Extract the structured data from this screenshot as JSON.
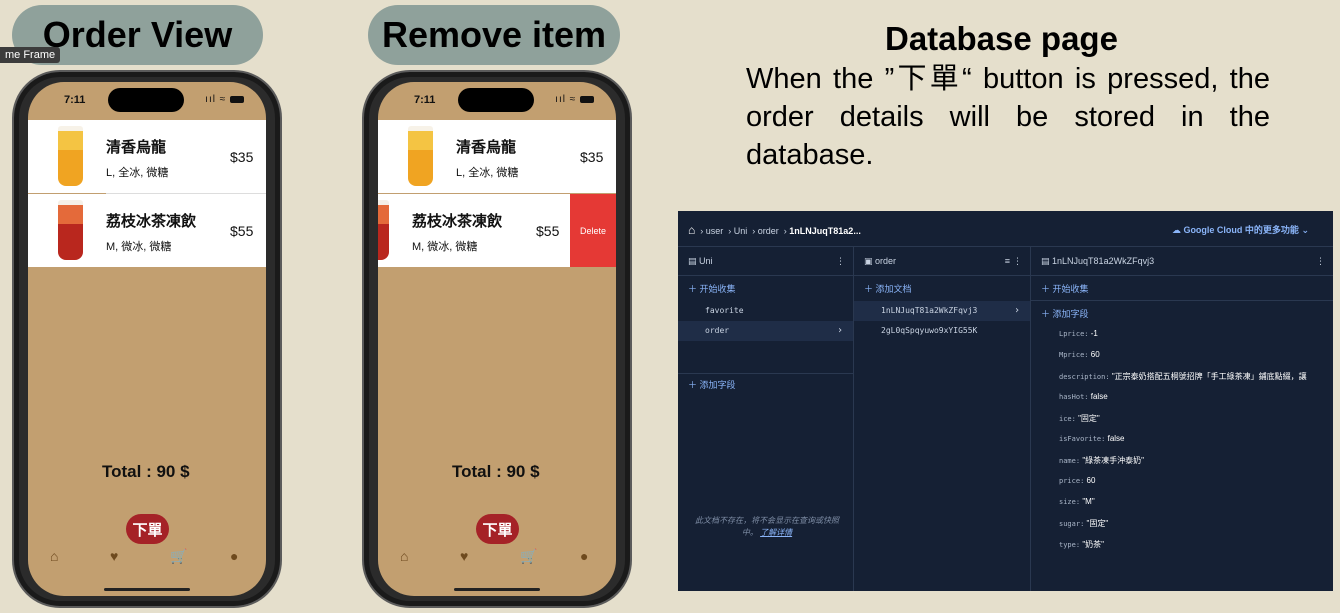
{
  "frame_tag": "me Frame",
  "panels": {
    "order_view": "Order View",
    "remove_item": "Remove item",
    "database_page": "Database page"
  },
  "description": "When the ”下單“ button is pressed, the order details will be stored in the database.",
  "phone": {
    "time": "7:11",
    "items": [
      {
        "name": "清香烏龍",
        "options": "L, 全冰, 微糖",
        "price": "$35"
      },
      {
        "name": "荔枝冰茶凍飲",
        "options": "M, 微冰, 微糖",
        "price": "$55"
      }
    ],
    "delete_label": "Delete",
    "total": "Total : 90 $",
    "order_button": "下單",
    "nav_icons": [
      "home-icon",
      "heart-icon",
      "cart-icon",
      "person-icon"
    ],
    "accent_color": "#1e88e5"
  },
  "console": {
    "breadcrumb": [
      "user",
      "Uni",
      "order",
      "1nLNJuqT81a2..."
    ],
    "google_cloud": "Google Cloud 中的更多功能",
    "col1": {
      "title": "Uni",
      "add_collection": "开始收集",
      "items": [
        "favorite",
        "order"
      ],
      "add_field": "添加字段",
      "note": "此文档不存在，将不会显示在查询或快照中。",
      "note_link": "了解详情"
    },
    "col2": {
      "title": "order",
      "add_doc": "添加文档",
      "items": [
        "1nLNJuqT81a2WkZFqvj3",
        "2gL0qSpqyuwo9xYIG55K"
      ]
    },
    "col3": {
      "title": "1nLNJuqT81a2WkZFqvj3",
      "add_collection": "开始收集",
      "add_field": "添加字段",
      "fields": [
        {
          "key": "Lprice:",
          "value": "-1"
        },
        {
          "key": "Mprice:",
          "value": "60"
        },
        {
          "key": "description:",
          "value": "\"正宗泰奶搭配五桐號招牌「手工綠茶凍」鋪底點綴，讓"
        },
        {
          "key": "hasHot:",
          "value": "false"
        },
        {
          "key": "ice:",
          "value": "\"固定\""
        },
        {
          "key": "isFavorite:",
          "value": "false"
        },
        {
          "key": "name:",
          "value": "\"綠茶凍手沖泰奶\""
        },
        {
          "key": "price:",
          "value": "60"
        },
        {
          "key": "size:",
          "value": "\"M\""
        },
        {
          "key": "sugar:",
          "value": "\"固定\""
        },
        {
          "key": "type:",
          "value": "\"奶茶\""
        }
      ]
    }
  }
}
